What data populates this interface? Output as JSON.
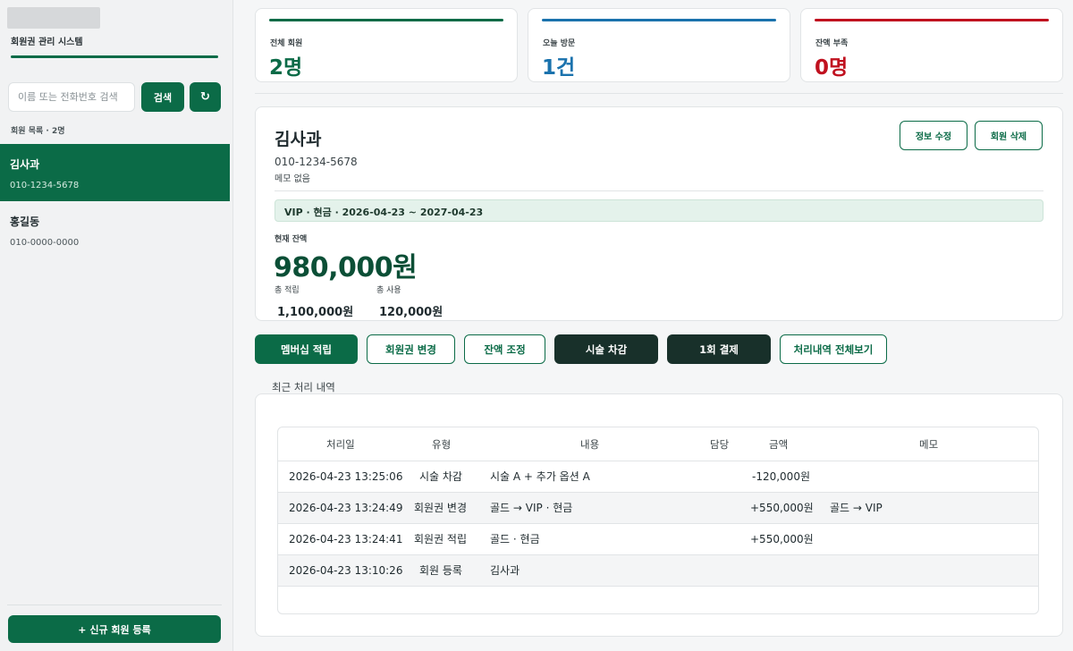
{
  "app": {
    "title": "회원권 관리 시스템"
  },
  "sidebar": {
    "search_placeholder": "이름 또는 전화번호 검색",
    "search_button": "검색",
    "refresh_icon": "↻",
    "list_label": "회원 목록 · 2명",
    "members": [
      {
        "name": "김사과",
        "phone": "010-1234-5678",
        "active": true
      },
      {
        "name": "홍길동",
        "phone": "010-0000-0000",
        "active": false
      }
    ],
    "register_button": "+ 신규 회원 등록"
  },
  "stats": [
    {
      "label": "전체 회원",
      "value": "2명",
      "color": "#0b6b47"
    },
    {
      "label": "오늘 방문",
      "value": "1건",
      "color": "#1a72ad"
    },
    {
      "label": "잔액 부족",
      "value": "0명",
      "color": "#c0111f"
    }
  ],
  "member": {
    "name": "김사과",
    "phone": "010-1234-5678",
    "memo": "메모 없음",
    "edit_button": "정보 수정",
    "delete_button": "회원 삭제",
    "plan": "VIP · 현금 · 2026-04-23 ~ 2027-04-23",
    "balance_label": "현재 잔액",
    "balance": "980,000원",
    "total_charge_label": "총 적립",
    "total_charge": "1,100,000원",
    "total_used_label": "총 사용",
    "total_used": "120,000원"
  },
  "actions": [
    {
      "label": "멤버십 적립",
      "style": "primary"
    },
    {
      "label": "회원권 변경",
      "style": "outline"
    },
    {
      "label": "잔액 조정",
      "style": "outline"
    },
    {
      "label": "시술 차감",
      "style": "dark"
    },
    {
      "label": "1회 결제",
      "style": "dark"
    },
    {
      "label": "처리내역 전체보기",
      "style": "outline"
    }
  ],
  "history": {
    "title": "최근 처리 내역",
    "headers": [
      "처리일",
      "유형",
      "내용",
      "담당",
      "금액",
      "메모"
    ],
    "rows": [
      [
        "2026-04-23 13:25:06",
        "시술 차감",
        "시술 A + 추가 옵션 A",
        "",
        "-120,000원",
        ""
      ],
      [
        "2026-04-23 13:24:49",
        "회원권 변경",
        "골드 → VIP · 현금",
        "",
        "+550,000원",
        "골드 → VIP"
      ],
      [
        "2026-04-23 13:24:41",
        "회원권 적립",
        "골드 · 현금",
        "",
        "+550,000원",
        ""
      ],
      [
        "2026-04-23 13:10:26",
        "회원 등록",
        "김사과",
        "",
        "",
        ""
      ]
    ]
  }
}
